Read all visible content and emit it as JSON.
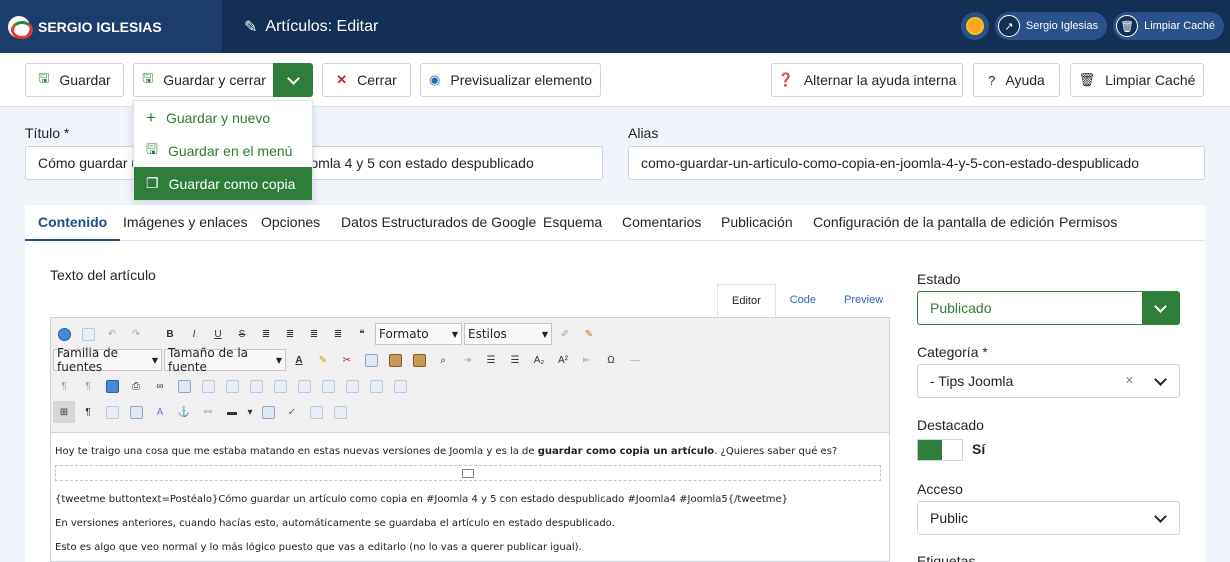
{
  "header": {
    "brand": "SERGIO IGLESIAS",
    "title": "Artículos: Editar",
    "user_label": "Sergio Iglesias",
    "cache_label": "Limpiar Caché"
  },
  "toolbar": {
    "save": "Guardar",
    "save_close": "Guardar y cerrar",
    "close": "Cerrar",
    "preview": "Previsualizar elemento",
    "help_toggle": "Alternar la ayuda interna",
    "help": "Ayuda",
    "clear_cache": "Limpiar Caché"
  },
  "dropdown": {
    "items": [
      "Guardar y nuevo",
      "Guardar en el menú",
      "Guardar como copia"
    ],
    "active_index": 2
  },
  "form": {
    "title_label": "Título *",
    "title_value": "Cómo guardar un artículo como copia en Joomla 4 y 5 con estado despublicado",
    "alias_label": "Alias",
    "alias_value": "como-guardar-un-articulo-como-copia-en-joomla-4-y-5-con-estado-despublicado"
  },
  "tabs": [
    "Contenido",
    "Imágenes y enlaces",
    "Opciones",
    "Datos Estructurados de Google",
    "Esquema",
    "Comentarios",
    "Publicación",
    "Configuración de la pantalla de edición",
    "Permisos"
  ],
  "editor": {
    "label": "Texto del artículo",
    "modes": [
      "Editor",
      "Code",
      "Preview"
    ],
    "format_select": "Formato",
    "styles_select": "Estilos",
    "font_family_select": "Familia de fuentes",
    "font_size_select": "Tamaño de la fuente",
    "paragraphs": {
      "p1_before": "Hoy te traigo una cosa que me estaba matando en estas nuevas versiones de Joomla y es la de ",
      "p1_bold": "guardar como copia un artículo",
      "p1_after": ". ¿Quieres saber qué es?",
      "p2": "{tweetme buttontext=Postéalo}Cómo guardar un artículo como copia en #Joomla 4 y 5 con estado despublicado #Joomla4 #Joomla5{/tweetme}",
      "p3": "En versiones anteriores, cuando hacías esto, automáticamente se guardaba el artículo en estado despublicado.",
      "p4": "Esto es algo que veo normal y lo más lógico puesto que vas a editarlo (no lo vas a querer publicar igual)."
    }
  },
  "sidebar": {
    "status_label": "Estado",
    "status_value": "Publicado",
    "category_label": "Categoría *",
    "category_value": "- Tips Joomla",
    "featured_label": "Destacado",
    "featured_value": "Sí",
    "access_label": "Acceso",
    "access_value": "Public",
    "tags_label": "Etiquetas"
  },
  "colors": {
    "header_bg": "#132f53",
    "accent_green": "#2e7d3a",
    "tab_active": "#1f4e88"
  }
}
